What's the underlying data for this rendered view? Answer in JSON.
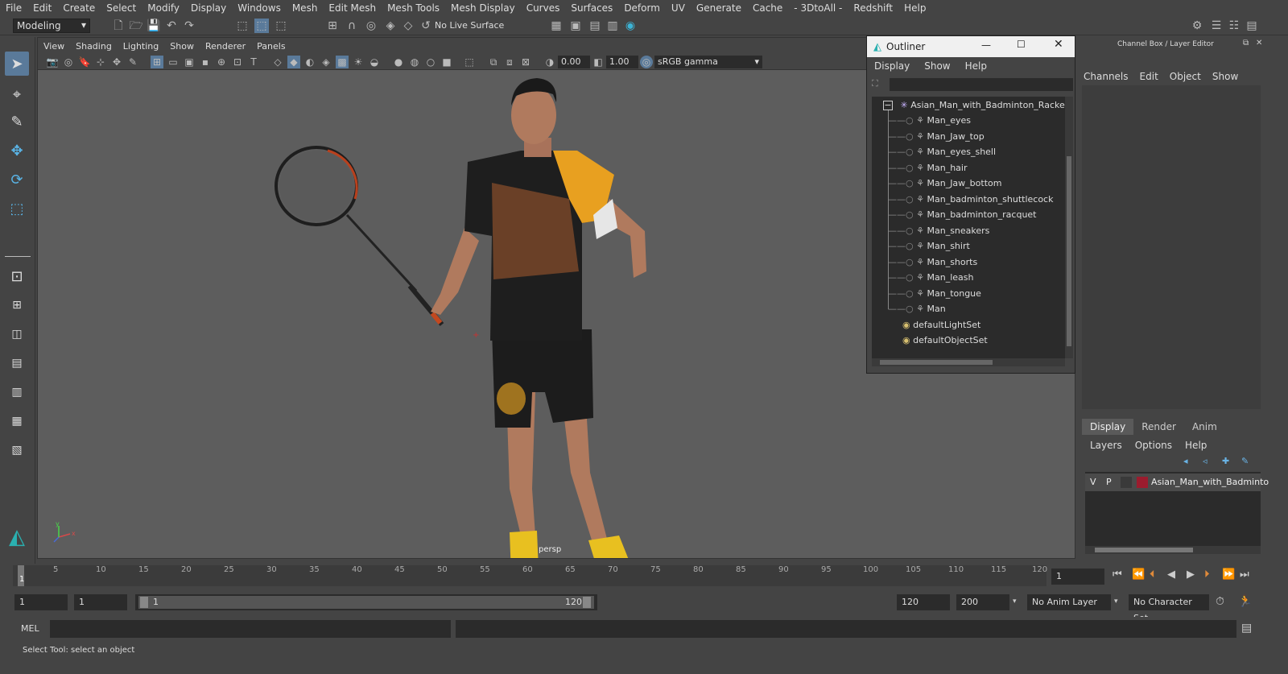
{
  "menubar": [
    "File",
    "Edit",
    "Create",
    "Select",
    "Modify",
    "Display",
    "Windows",
    "Mesh",
    "Edit Mesh",
    "Mesh Tools",
    "Mesh Display",
    "Curves",
    "Surfaces",
    "Deform",
    "UV",
    "Generate",
    "Cache",
    "- 3DtoAll -",
    "Redshift",
    "Help"
  ],
  "toolbar": {
    "mode": "Modeling",
    "live_surface": "No Live Surface"
  },
  "viewport": {
    "menu": [
      "View",
      "Shading",
      "Lighting",
      "Show",
      "Renderer",
      "Panels"
    ],
    "exposure": "0.00",
    "gamma": "1.00",
    "color_space": "sRGB gamma",
    "camera_label": "persp"
  },
  "outliner": {
    "title": "Outliner",
    "menu": [
      "Display",
      "Show",
      "Help"
    ],
    "root": "Asian_Man_with_Badminton_Racket",
    "children": [
      "Man_eyes",
      "Man_Jaw_top",
      "Man_eyes_shell",
      "Man_hair",
      "Man_Jaw_bottom",
      "Man_badminton_shuttlecock",
      "Man_badminton_racquet",
      "Man_sneakers",
      "Man_shirt",
      "Man_shorts",
      "Man_leash",
      "Man_tongue",
      "Man"
    ],
    "sets": [
      "defaultLightSet",
      "defaultObjectSet"
    ]
  },
  "channel_box": {
    "title": "Channel Box / Layer Editor",
    "menu": [
      "Channels",
      "Edit",
      "Object",
      "Show"
    ],
    "tabs": [
      "Display",
      "Render",
      "Anim"
    ],
    "layer_menu": [
      "Layers",
      "Options",
      "Help"
    ],
    "layer": {
      "v": "V",
      "p": "P",
      "name": "Asian_Man_with_Badminto",
      "color": "#9b1c2e"
    }
  },
  "timeline": {
    "ticks": [
      "5",
      "10",
      "15",
      "20",
      "25",
      "30",
      "35",
      "40",
      "45",
      "50",
      "55",
      "60",
      "65",
      "70",
      "75",
      "80",
      "85",
      "90",
      "95",
      "100",
      "105",
      "110",
      "115",
      "120"
    ],
    "current_frame_marker": "1",
    "current_frame": "1"
  },
  "range": {
    "start": "1",
    "playback_start": "1",
    "slider_start": "1",
    "slider_end": "120",
    "playback_end": "120",
    "end": "200",
    "anim_layer": "No Anim Layer",
    "character_set": "No Character Set"
  },
  "mel": {
    "label": "MEL"
  },
  "status": {
    "text": "Select Tool: select an object"
  },
  "accent": "#5a7a9a"
}
